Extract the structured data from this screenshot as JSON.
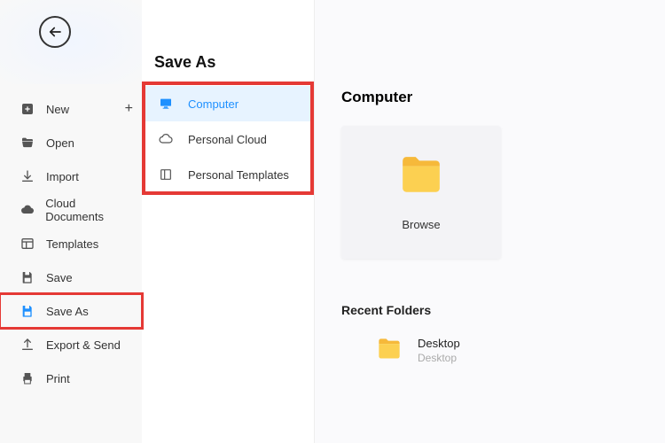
{
  "sidebar": {
    "items": [
      {
        "label": "New",
        "icon": "plus-square-icon",
        "extra_plus": true
      },
      {
        "label": "Open",
        "icon": "folder-open-icon"
      },
      {
        "label": "Import",
        "icon": "download-icon"
      },
      {
        "label": "Cloud Documents",
        "icon": "cloud-icon"
      },
      {
        "label": "Templates",
        "icon": "templates-icon"
      },
      {
        "label": "Save",
        "icon": "save-icon"
      },
      {
        "label": "Save As",
        "icon": "save-as-icon",
        "active": true,
        "highlighted": true
      },
      {
        "label": "Export & Send",
        "icon": "export-icon"
      },
      {
        "label": "Print",
        "icon": "print-icon"
      }
    ]
  },
  "panel": {
    "title": "Save As",
    "destinations": [
      {
        "label": "Computer",
        "icon": "monitor-icon",
        "selected": true
      },
      {
        "label": "Personal Cloud",
        "icon": "cloud-outline-icon"
      },
      {
        "label": "Personal Templates",
        "icon": "template-grid-icon"
      }
    ]
  },
  "right": {
    "title": "Computer",
    "browse_label": "Browse",
    "recent_title": "Recent Folders",
    "recent": [
      {
        "name": "Desktop",
        "path": "Desktop"
      }
    ]
  },
  "colors": {
    "accent": "#1e90ff",
    "highlight_box": "#e53935",
    "folder_fill": "#fbc02d"
  }
}
